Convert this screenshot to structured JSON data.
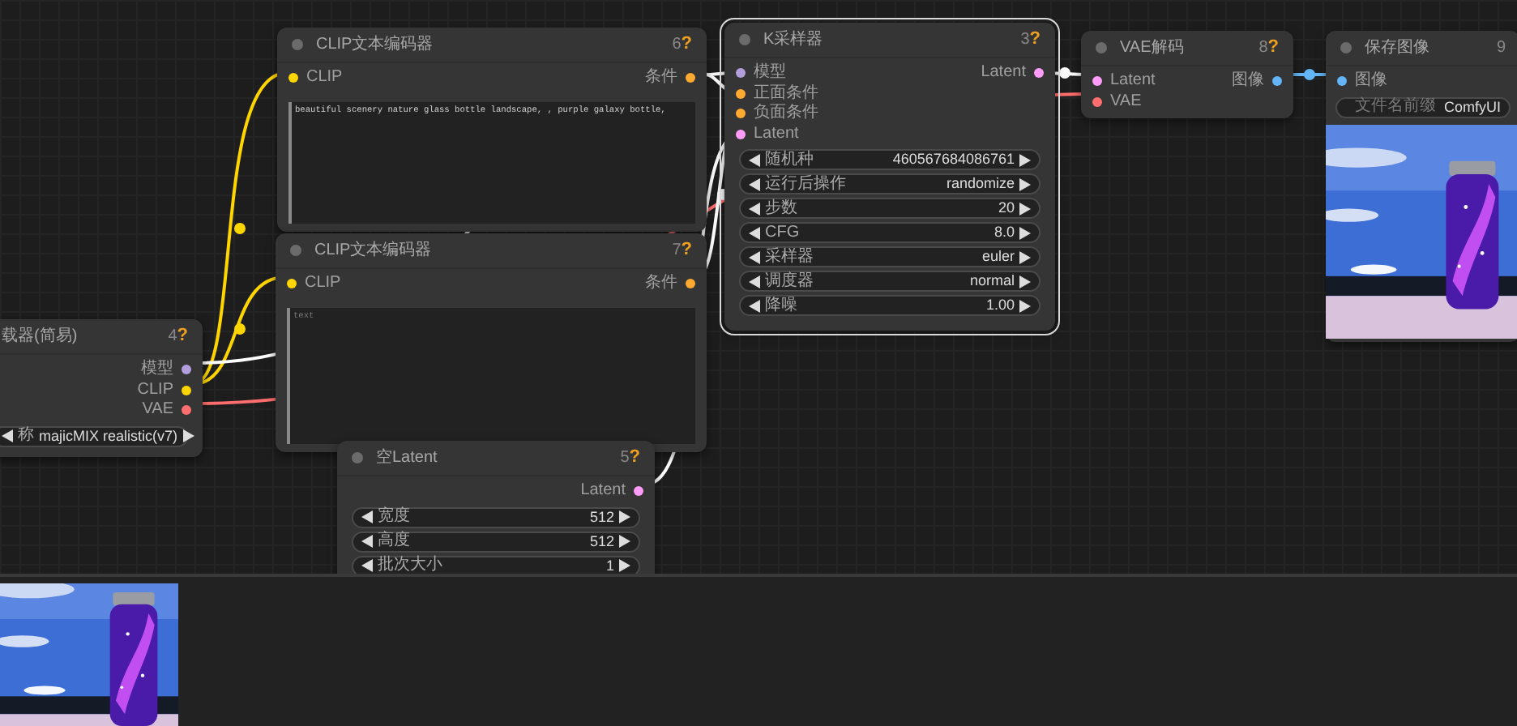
{
  "nodes": [
    {
      "title": "CLIP文本编码器",
      "number": "6",
      "help_mark": "?",
      "selected": false,
      "inputs": [
        {
          "label": "CLIP",
          "color": "#ffd500"
        }
      ],
      "outputs": [
        {
          "label": "条件",
          "color": "#ffa931"
        }
      ],
      "widgets": [
        {
          "kind": "textarea",
          "value": "beautiful scenery nature glass bottle landscape, , purple galaxy bottle,"
        }
      ]
    },
    {
      "title": "K采样器",
      "number": "3",
      "help_mark": "?",
      "selected": true,
      "inputs": [
        {
          "label": "模型",
          "color": "#b39ddb"
        },
        {
          "label": "正面条件",
          "color": "#ffa931"
        },
        {
          "label": "负面条件",
          "color": "#ffa931"
        },
        {
          "label": "Latent",
          "color": "#ff9cf9"
        }
      ],
      "outputs": [
        {
          "label": "Latent",
          "color": "#ff9cf9"
        }
      ],
      "widgets": [
        {
          "kind": "number",
          "label": "随机种",
          "value": "460567684086761"
        },
        {
          "kind": "combo",
          "label": "运行后操作",
          "value": "randomize"
        },
        {
          "kind": "number",
          "label": "步数",
          "value": "20"
        },
        {
          "kind": "number",
          "label": "CFG",
          "value": "8.0"
        },
        {
          "kind": "combo",
          "label": "采样器",
          "value": "euler"
        },
        {
          "kind": "combo",
          "label": "调度器",
          "value": "normal"
        },
        {
          "kind": "number",
          "label": "降噪",
          "value": "1.00"
        }
      ]
    },
    {
      "title": "VAE解码",
      "number": "8",
      "help_mark": "?",
      "selected": false,
      "inputs": [
        {
          "label": "Latent",
          "color": "#ff9cf9"
        },
        {
          "label": "VAE",
          "color": "#ff6e6e"
        }
      ],
      "outputs": [
        {
          "label": "图像",
          "color": "#64b5f6"
        }
      ]
    },
    {
      "title": "保存图像",
      "number": "9",
      "selected": false,
      "inputs": [
        {
          "label": "图像",
          "color": "#64b5f6"
        }
      ],
      "widgets": [
        {
          "kind": "text",
          "label": "文件名前缀",
          "value": "ComfyUI"
        }
      ],
      "preview": {
        "kind": "picture"
      }
    },
    {
      "title": "CLIP文本编码器",
      "number": "7",
      "help_mark": "?",
      "selected": false,
      "inputs": [
        {
          "label": "CLIP",
          "color": "#ffd500"
        }
      ],
      "outputs": [
        {
          "label": "条件",
          "color": "#ffa931"
        }
      ],
      "widgets": [
        {
          "kind": "textarea",
          "placeholder": "text"
        }
      ]
    },
    {
      "title": "载器(简易)",
      "number": "4",
      "help_mark": "?",
      "selected": false,
      "outputs": [
        {
          "label": "模型",
          "color": "#b39ddb"
        },
        {
          "label": "CLIP",
          "color": "#ffd500"
        },
        {
          "label": "VAE",
          "color": "#ff6e6e"
        }
      ],
      "widgets": [
        {
          "kind": "combo",
          "label": "称",
          "value": "majicMIX realistic(v7)"
        }
      ]
    },
    {
      "title": "空Latent",
      "number": "5",
      "help_mark": "?",
      "selected": false,
      "outputs": [
        {
          "label": "Latent",
          "color": "#ff9cf9"
        }
      ],
      "widgets": [
        {
          "kind": "number",
          "label": "宽度",
          "value": "512"
        },
        {
          "kind": "number",
          "label": "高度",
          "value": "512"
        },
        {
          "kind": "number",
          "label": "批次大小",
          "value": "1"
        }
      ]
    }
  ],
  "bottom_panel": {
    "images": [
      {
        "kind": "picture"
      }
    ]
  }
}
